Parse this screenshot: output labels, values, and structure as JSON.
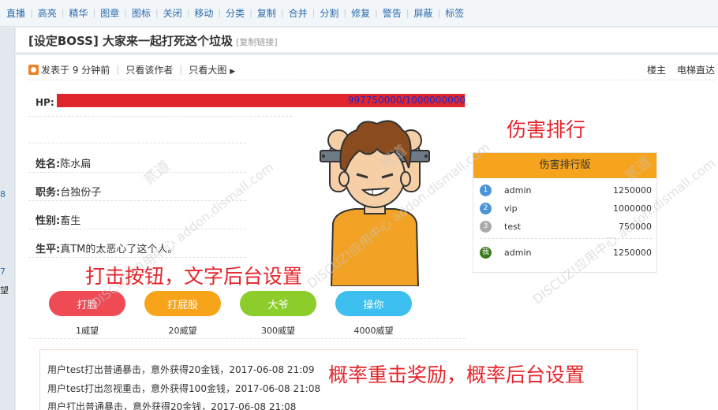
{
  "toolbar": {
    "items": [
      "直播",
      "高亮",
      "精华",
      "图章",
      "图标",
      "关闭",
      "移动",
      "分类",
      "复制",
      "合并",
      "分割",
      "修复",
      "警告",
      "屏蔽",
      "标签"
    ]
  },
  "gutter": {
    "t1": "8",
    "t2": "7",
    "t3": "望"
  },
  "post": {
    "title": "[设定BOSS] 大家来一起打死这个垃圾",
    "copy_link": "[复制链接]",
    "posted": "发表于 9 分钟前",
    "only_author": "只看该作者",
    "only_big_image": "只看大图",
    "floor_label": "楼主",
    "elevator": "电梯直达"
  },
  "boss": {
    "hp_label": "HP:",
    "hp_text": "997750000/1000000000",
    "hp_current": 997750000,
    "hp_max": 1000000000,
    "name_label": "姓名:",
    "name": "陈水扁",
    "job_label": "职务:",
    "job": "台独份子",
    "gender_label": "性别:",
    "gender": "畜生",
    "bio_label": "生平:",
    "bio": "真TM的太恶心了这个人。"
  },
  "actions": [
    {
      "label": "打脸",
      "price": "1威望",
      "color": "#ee4b55"
    },
    {
      "label": "打屁股",
      "price": "20威望",
      "color": "#f7a41b"
    },
    {
      "label": "大爷",
      "price": "300威望",
      "color": "#8ccd2c"
    },
    {
      "label": "操你",
      "price": "4000威望",
      "color": "#3dc0ef"
    }
  ],
  "ranking": {
    "title": "伤害排行版",
    "rows": [
      {
        "badge": "1",
        "name": "admin",
        "score": "1250000",
        "color": "#4b94d8"
      },
      {
        "badge": "2",
        "name": "vip",
        "score": "1000000",
        "color": "#4b94d8"
      },
      {
        "badge": "3",
        "name": "test",
        "score": "750000",
        "color": "#a9a9a9"
      },
      {
        "badge": "我",
        "name": "admin",
        "score": "1250000",
        "color": "#3b7a1c"
      }
    ]
  },
  "logs": [
    "用户test打出普通暴击，意外获得20金钱，2017-06-08 21:09",
    "用户test打出忽视重击，意外获得100金钱，2017-06-08 21:08",
    "用户打出普通暴击，意外获得20金钱，2017-06-08 21:08"
  ],
  "annotations": {
    "rank": "伤害排行",
    "buttons": "打击按钮，文字后台设置",
    "chance": "概率重击奖励，概率后台设置"
  },
  "watermark": {
    "brand": "DISCUZ!应用中心",
    "site": "addon.dismall.com",
    "tag": "贰道"
  }
}
